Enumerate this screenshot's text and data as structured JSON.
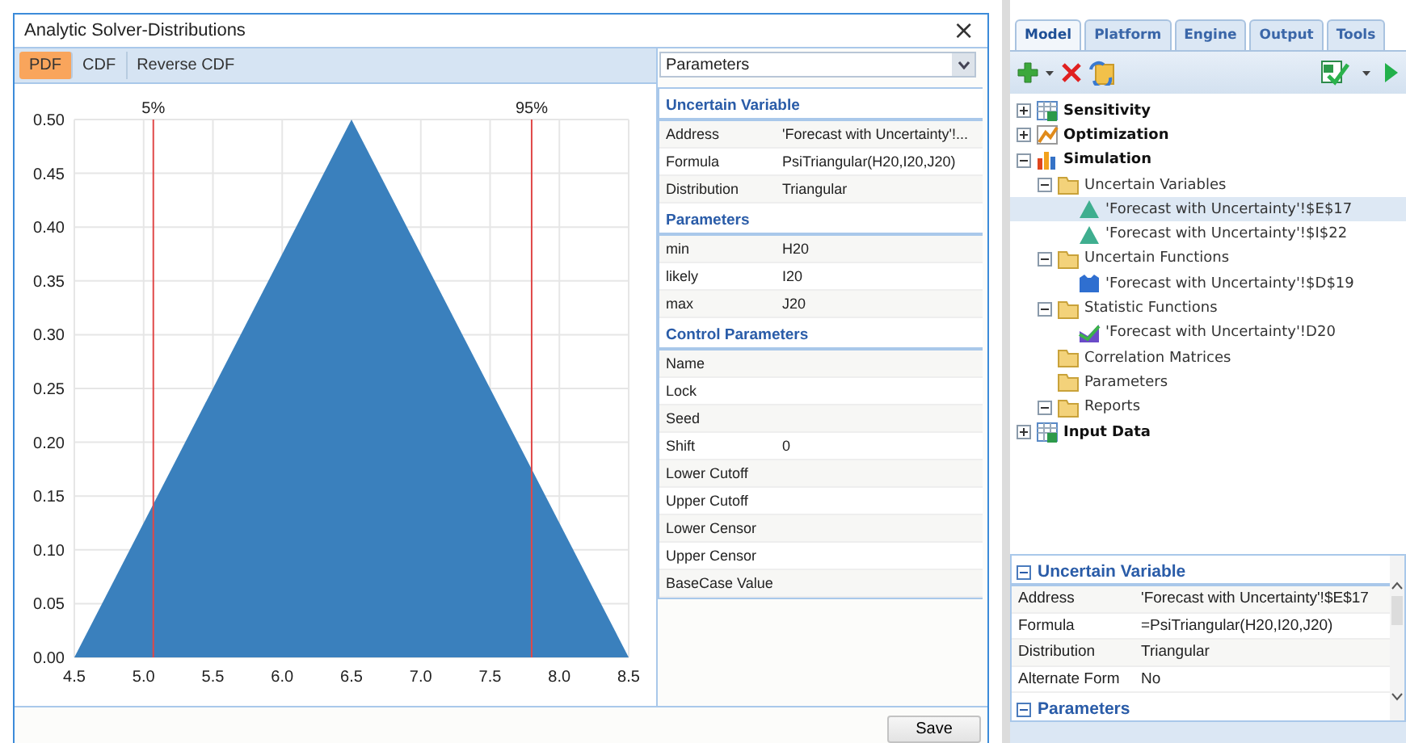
{
  "dialog": {
    "title": "Analytic Solver-Distributions",
    "close": "×",
    "view_tabs": [
      {
        "label": "PDF",
        "selected": true
      },
      {
        "label": "CDF",
        "selected": false
      },
      {
        "label": "Reverse CDF",
        "selected": false
      }
    ],
    "chart": {
      "chart_data": {
        "type": "area",
        "x": [
          4.5,
          6.5,
          8.5
        ],
        "series": [
          {
            "color": "#3a80bd",
            "values": [
              0,
              0.5,
              0
            ]
          }
        ],
        "grid": true,
        "xlim": [
          4.5,
          8.5
        ],
        "ylim": [
          0,
          0.5
        ],
        "xticks": [
          {
            "value": 4.5,
            "label": "4.5"
          },
          {
            "value": 5,
            "label": "5.0"
          },
          {
            "value": 5.5,
            "label": "5.5"
          },
          {
            "value": 6,
            "label": "6.0"
          },
          {
            "value": 6.5,
            "label": "6.5"
          },
          {
            "value": 7,
            "label": "7.0"
          },
          {
            "value": 7.5,
            "label": "7.5"
          },
          {
            "value": 8,
            "label": "8.0"
          },
          {
            "value": 8.5,
            "label": "8.5"
          }
        ],
        "yticks": [
          {
            "value": 0,
            "label": "0.00"
          },
          {
            "value": 0.05,
            "label": "0.05"
          },
          {
            "value": 0.1,
            "label": "0.10"
          },
          {
            "value": 0.15,
            "label": "0.15"
          },
          {
            "value": 0.2,
            "label": "0.20"
          },
          {
            "value": 0.25,
            "label": "0.25"
          },
          {
            "value": 0.3,
            "label": "0.30"
          },
          {
            "value": 0.35,
            "label": "0.35"
          },
          {
            "value": 0.4,
            "label": "0.40"
          },
          {
            "value": 0.45,
            "label": "0.45"
          },
          {
            "value": 0.5,
            "label": "0.50"
          }
        ],
        "ref_lines": [
          {
            "axis": "x",
            "value": 5.07,
            "color": "#e04848"
          },
          {
            "axis": "x",
            "value": 7.8,
            "color": "#e04848"
          }
        ],
        "annotations": [
          "5%",
          "95%"
        ]
      }
    },
    "panel_selector": "Parameters",
    "parameters": {
      "sections": [
        {
          "title": "Uncertain Variable",
          "rows": [
            {
              "label": "Address",
              "value": "'Forecast with Uncertainty'!..."
            },
            {
              "label": "Formula",
              "value": "PsiTriangular(H20,I20,J20)"
            },
            {
              "label": "Distribution",
              "value": "Triangular"
            }
          ]
        },
        {
          "title": "Parameters",
          "rows": [
            {
              "label": "min",
              "value": "H20"
            },
            {
              "label": "likely",
              "value": "I20"
            },
            {
              "label": "max",
              "value": "J20"
            }
          ]
        },
        {
          "title": "Control Parameters",
          "rows": [
            {
              "label": "Name"
            },
            {
              "label": "Lock"
            },
            {
              "label": "Seed"
            },
            {
              "label": "Shift",
              "value": "0"
            },
            {
              "label": "Lower Cutoff"
            },
            {
              "label": "Upper Cutoff"
            },
            {
              "label": "Lower Censor"
            },
            {
              "label": "Upper Censor"
            },
            {
              "label": "BaseCase Value"
            }
          ]
        }
      ]
    },
    "save_button": "Save"
  },
  "solver": {
    "tabs": [
      {
        "label": "Model",
        "selected": true
      },
      {
        "label": "Platform",
        "selected": false
      },
      {
        "label": "Engine",
        "selected": false
      },
      {
        "label": "Output",
        "selected": false
      },
      {
        "label": "Tools",
        "selected": false
      }
    ],
    "tree": [
      {
        "label": "Sensitivity",
        "kind": "sheet",
        "expanded": false,
        "selected": false
      },
      {
        "label": "Optimization",
        "kind": "optimization",
        "expanded": false,
        "selected": false
      },
      {
        "label": "Simulation",
        "kind": "simulation",
        "expanded": true,
        "selected": false,
        "children": [
          {
            "label": "Uncertain Variables",
            "kind": "folder",
            "expanded": true,
            "selected": false,
            "children": [
              {
                "label": "'Forecast with Uncertainty'!$E$17",
                "kind": "variable",
                "selected": true
              },
              {
                "label": "'Forecast with Uncertainty'!$I$22",
                "kind": "variable",
                "selected": false
              }
            ]
          },
          {
            "label": "Uncertain Functions",
            "kind": "folder",
            "expanded": true,
            "selected": false,
            "children": [
              {
                "label": "'Forecast with Uncertainty'!$D$19",
                "kind": "function",
                "selected": false
              }
            ]
          },
          {
            "label": "Statistic Functions",
            "kind": "folder",
            "expanded": true,
            "selected": false,
            "children": [
              {
                "label": "'Forecast with Uncertainty'!D20",
                "kind": "statistic",
                "selected": false
              }
            ]
          },
          {
            "label": "Correlation Matrices",
            "kind": "folder",
            "selected": false
          },
          {
            "label": "Parameters",
            "kind": "folder",
            "selected": false
          },
          {
            "label": "Reports",
            "kind": "folder",
            "expanded": true,
            "selected": false
          }
        ]
      },
      {
        "label": "Input Data",
        "kind": "sheet",
        "expanded": false,
        "selected": false
      }
    ],
    "properties": {
      "sections": [
        {
          "title": "Uncertain Variable",
          "expanded": true,
          "rows": [
            {
              "label": "Address",
              "value": "'Forecast with Uncertainty'!$E$17"
            },
            {
              "label": "Formula",
              "value": "=PsiTriangular(H20,I20,J20)"
            },
            {
              "label": "Distribution",
              "value": "Triangular"
            },
            {
              "label": "Alternate Form",
              "value": "No"
            }
          ]
        },
        {
          "title": "Parameters",
          "expanded": true
        }
      ]
    }
  }
}
